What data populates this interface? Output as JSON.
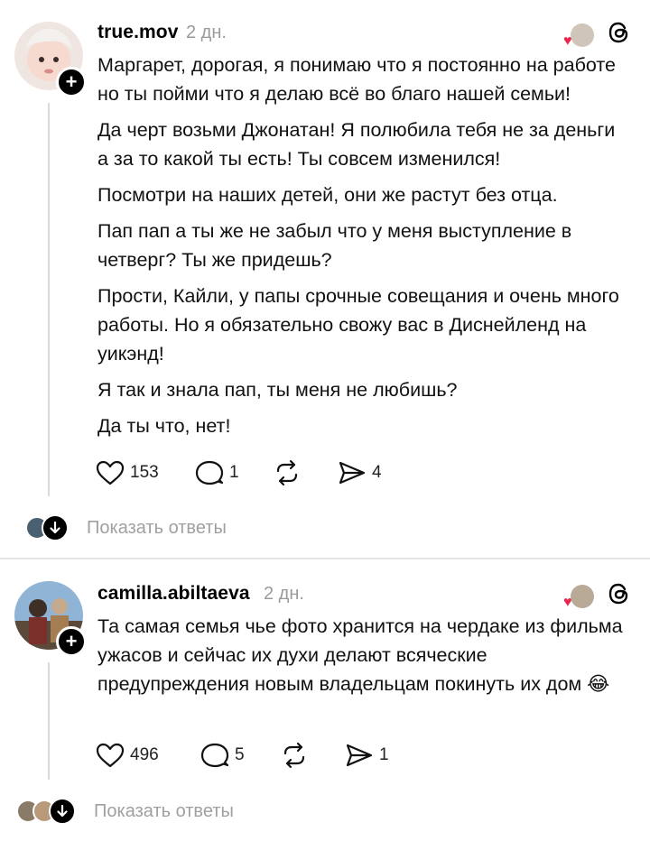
{
  "posts": [
    {
      "username": "true.mov",
      "time": "2 дн.",
      "paragraphs": [
        "Маргарет, дорогая, я понимаю что я постоянно на работе но ты пойми что я делаю всё во благо нашей семьи!",
        "Да черт возьми Джонатан! Я полюбила тебя не за деньги а за то какой ты есть! Ты совсем изменился!",
        "Посмотри на наших детей, они же растут без отца.",
        "Пап пап а ты же не забыл что у меня выступление в четверг? Ты же придешь?",
        "Прости, Кайли, у папы срочные совещания и очень много работы. Но я обязательно свожу вас в Диснейленд на уикэнд!",
        "Я так и знала пап, ты меня не любишь?",
        "Да ты что, нет!"
      ],
      "likes": "153",
      "comments": "1",
      "shares": "4",
      "show_replies": "Показать ответы"
    },
    {
      "username": "camilla.abiltaeva",
      "time": "2 дн.",
      "paragraphs": [
        "Та самая семья чье фото хранится на чердаке из фильма ужасов и сейчас их духи делают всяческие предупреждения новым владельцам покинуть их дом 😂"
      ],
      "likes": "496",
      "comments": "5",
      "shares": "1",
      "show_replies": "Показать ответы"
    }
  ],
  "icons": {
    "like": "heart-outline-icon",
    "comment": "speech-bubble-icon",
    "repost": "repost-icon",
    "share": "send-icon",
    "app": "threads-logo-icon"
  },
  "colors": {
    "muted": "#9a9a9a",
    "reaction_heart": "#e8264f"
  }
}
